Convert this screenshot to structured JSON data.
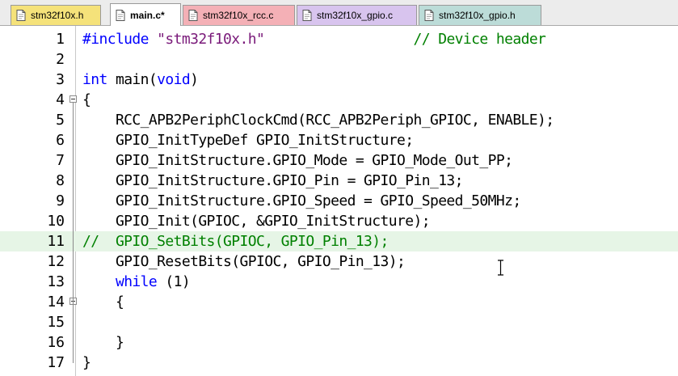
{
  "tabs": [
    {
      "label": "stm32f10x.h",
      "color": "#f5e27a",
      "active": false
    },
    {
      "label": "main.c*",
      "color": "#ffffff",
      "active": true
    },
    {
      "label": "stm32f10x_rcc.c",
      "color": "#f4b0b6",
      "active": false
    },
    {
      "label": "stm32f10x_gpio.c",
      "color": "#d8c4ee",
      "active": false
    },
    {
      "label": "stm32f10x_gpio.h",
      "color": "#bcdcd8",
      "active": false
    }
  ],
  "lines": [
    {
      "num": "1",
      "segments": [
        {
          "t": "#include ",
          "c": "kw"
        },
        {
          "t": "\"stm32f10x.h\"",
          "c": "str"
        },
        {
          "t": "                  ",
          "c": ""
        },
        {
          "t": "// Device header",
          "c": "cm"
        }
      ]
    },
    {
      "num": "2",
      "segments": []
    },
    {
      "num": "3",
      "segments": [
        {
          "t": "int",
          "c": "kw"
        },
        {
          "t": " main(",
          "c": ""
        },
        {
          "t": "void",
          "c": "kw"
        },
        {
          "t": ")",
          "c": ""
        }
      ]
    },
    {
      "num": "4",
      "segments": [
        {
          "t": "{",
          "c": ""
        }
      ],
      "fold": true
    },
    {
      "num": "5",
      "segments": [
        {
          "t": "    RCC_APB2PeriphClockCmd(RCC_APB2Periph_GPIOC, ENABLE);",
          "c": ""
        }
      ]
    },
    {
      "num": "6",
      "segments": [
        {
          "t": "    GPIO_InitTypeDef GPIO_InitStructure;",
          "c": ""
        }
      ]
    },
    {
      "num": "7",
      "segments": [
        {
          "t": "    GPIO_InitStructure.GPIO_Mode = GPIO_Mode_Out_PP;",
          "c": ""
        }
      ]
    },
    {
      "num": "8",
      "segments": [
        {
          "t": "    GPIO_InitStructure.GPIO_Pin = GPIO_Pin_13;",
          "c": ""
        }
      ]
    },
    {
      "num": "9",
      "segments": [
        {
          "t": "    GPIO_InitStructure.GPIO_Speed = GPIO_Speed_50MHz;",
          "c": ""
        }
      ]
    },
    {
      "num": "10",
      "segments": [
        {
          "t": "    GPIO_Init(GPIOC, &GPIO_InitStructure);",
          "c": ""
        }
      ]
    },
    {
      "num": "11",
      "segments": [
        {
          "t": "//  GPIO_SetBits(GPIOC, GPIO_Pin_13);",
          "c": "cm"
        }
      ],
      "highlight": true
    },
    {
      "num": "12",
      "segments": [
        {
          "t": "    GPIO_ResetBits(GPIOC, GPIO_Pin_13);",
          "c": ""
        }
      ]
    },
    {
      "num": "13",
      "segments": [
        {
          "t": "    ",
          "c": ""
        },
        {
          "t": "while",
          "c": "kw"
        },
        {
          "t": " (1)",
          "c": ""
        }
      ]
    },
    {
      "num": "14",
      "segments": [
        {
          "t": "    {",
          "c": ""
        }
      ],
      "fold": true
    },
    {
      "num": "15",
      "segments": []
    },
    {
      "num": "16",
      "segments": [
        {
          "t": "    }",
          "c": ""
        }
      ]
    },
    {
      "num": "17",
      "segments": [
        {
          "t": "}",
          "c": ""
        }
      ]
    }
  ]
}
